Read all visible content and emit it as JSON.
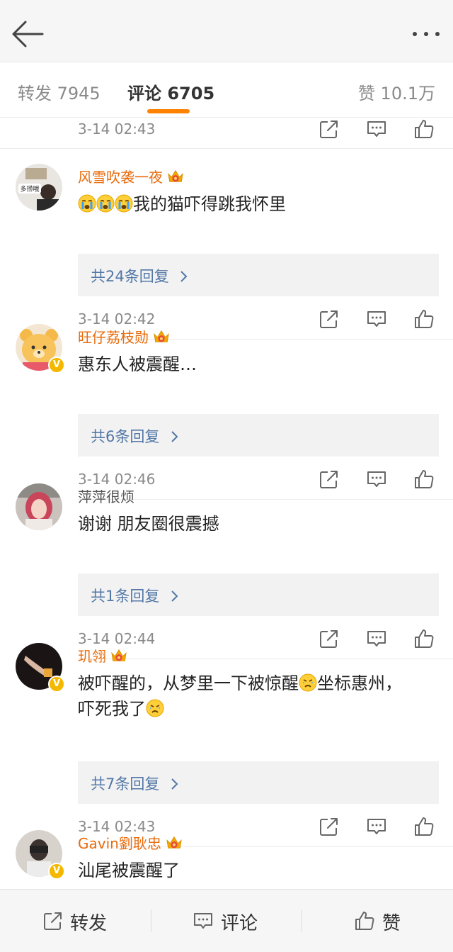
{
  "header": {
    "back_icon": "arrow-left-icon",
    "more_icon": "more-dots-icon"
  },
  "tabs": [
    {
      "label": "转发 7945",
      "active": false
    },
    {
      "label": "评论 6705",
      "active": true
    },
    {
      "label": "赞 10.1万",
      "active": false
    }
  ],
  "accent_color": "#ff8200",
  "link_color": "#5277a7",
  "vip_name_color": "#e86b0c",
  "prev_comment": {
    "time": "3-14 02:43"
  },
  "comments": [
    {
      "name": "风雪吹袭一夜",
      "vip": true,
      "verified": false,
      "avatar_badge_text": "多捞哦",
      "text": "我的猫吓得跳我怀里",
      "emoji_prefix_count": 3,
      "replies": "共24条回复",
      "time": "3-14 02:42"
    },
    {
      "name": "旺仔荔枝勋",
      "vip": true,
      "verified": true,
      "text": "惠东人被震醒…",
      "replies": "共6条回复",
      "time": "3-14 02:46"
    },
    {
      "name": "萍萍很烦",
      "vip": false,
      "verified": false,
      "text": "谢谢 朋友圈很震撼",
      "replies": "共1条回复",
      "time": "3-14 02:44"
    },
    {
      "name": "玑翎",
      "vip": true,
      "verified": true,
      "text_part1": "被吓醒的，从梦里一下被惊醒",
      "text_part2": "坐标惠州，",
      "text_part3": "吓死我了",
      "replies": "共7条回复",
      "time": "3-14 02:43"
    },
    {
      "name": "Gavin劉耿忠",
      "vip": true,
      "verified": true,
      "text": "汕尾被震醒了"
    }
  ],
  "verified_mark": "V",
  "bottom_bar": {
    "repost": {
      "label": "转发",
      "icon": "share-icon"
    },
    "comment": {
      "label": "评论",
      "icon": "comment-icon"
    },
    "like": {
      "label": "赞",
      "icon": "thumbs-up-icon"
    }
  },
  "action_icons": [
    "share-icon",
    "comment-icon",
    "thumbs-up-icon"
  ]
}
